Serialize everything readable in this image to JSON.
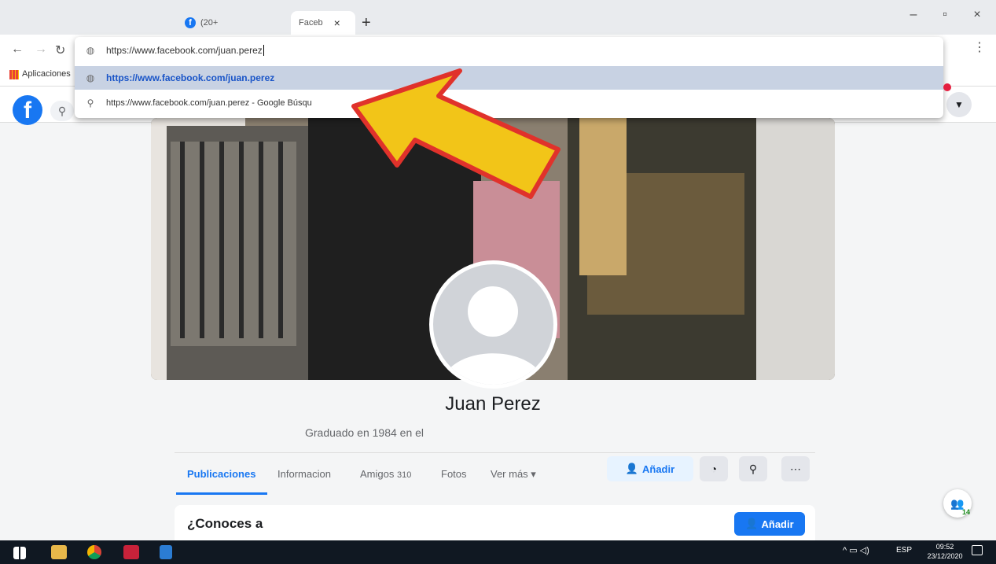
{
  "browser": {
    "tabs": [
      {
        "label": "(20+",
        "icon": "facebook-icon"
      },
      {
        "label": "Faceb",
        "close": "×"
      }
    ],
    "new_tab": "+",
    "url_typed": "https://www.facebook.com/juan.perez",
    "bookmarks_label": "Aplicaciones",
    "suggestions": [
      {
        "text": "https://www.facebook.com/juan.perez",
        "icon": "globe-icon"
      },
      {
        "text": "https://www.facebook.com/juan.perez - Google Búsqu",
        "icon": "search-icon"
      }
    ],
    "window_controls": [
      "–",
      "▫",
      "×"
    ],
    "menu": "⋮"
  },
  "facebook": {
    "logo": "f",
    "profile_name": "Juan Perez",
    "bio": "Graduado en 1984 en el",
    "tabs": [
      {
        "label": "Publicaciones",
        "active": true
      },
      {
        "label": "Informacion"
      },
      {
        "label": "Amigos",
        "count": "310"
      },
      {
        "label": "Fotos"
      },
      {
        "label": "Ver más ▾"
      }
    ],
    "add_button": "Añadir",
    "card_title": "¿Conoces a",
    "card_button": "Añadir",
    "contacts_badge": "14"
  },
  "taskbar": {
    "lang": "ESP",
    "time": "09:52",
    "date": "23/12/2020"
  },
  "colors": {
    "accent": "#1877f2",
    "arrow_fill": "#f2c518",
    "arrow_border": "#e0322b"
  }
}
